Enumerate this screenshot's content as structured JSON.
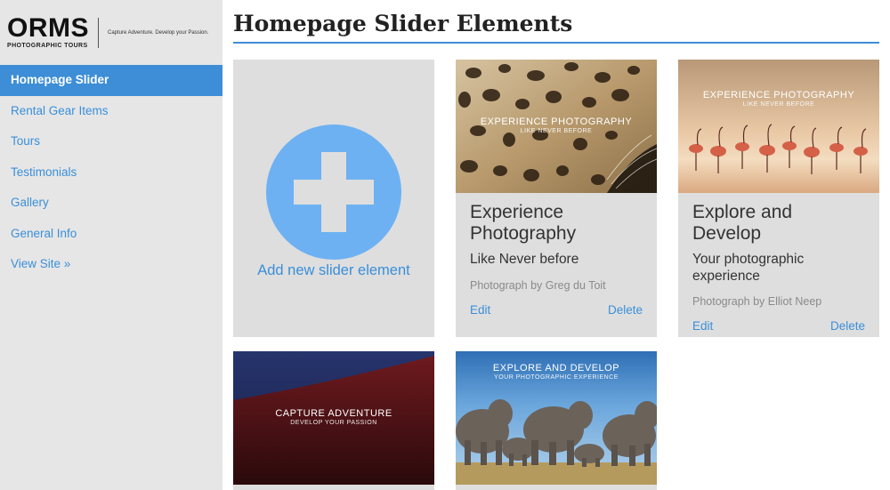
{
  "brand": {
    "logo_text": "ORMS",
    "logo_sub": "PHOTOGRAPHIC TOURS",
    "tagline": "Capture Adventure.  Develop your Passion."
  },
  "colors": {
    "accent": "#3d8ed6",
    "link": "#3a8fd9",
    "add_circle": "#6db1f2",
    "card_bg": "#dedede",
    "sidebar_bg": "#e6e6e6"
  },
  "nav": {
    "items": [
      {
        "label": "Homepage Slider",
        "active": true
      },
      {
        "label": "Rental Gear Items"
      },
      {
        "label": "Tours"
      },
      {
        "label": "Testimonials"
      },
      {
        "label": "Gallery"
      },
      {
        "label": "General Info"
      },
      {
        "label": "View Site »"
      }
    ]
  },
  "page": {
    "title": "Homepage Slider Elements"
  },
  "add_card": {
    "label": "Add new slider element",
    "icon": "plus-circle-icon"
  },
  "cards": [
    {
      "title": "Experience Photography",
      "subtitle": "Like Never before",
      "credit": "Photograph by Greg du Toit",
      "slide_heading": "EXPERIENCE PHOTOGRAPHY",
      "slide_tagline": "LIKE NEVER BEFORE",
      "edit": "Edit",
      "delete": "Delete"
    },
    {
      "title": "Explore and Develop",
      "subtitle": "Your photographic experience",
      "credit": "Photograph by Elliot Neep",
      "slide_heading": "EXPERIENCE PHOTOGRAPHY",
      "slide_tagline": "LIKE NEVER BEFORE",
      "edit": "Edit",
      "delete": "Delete"
    },
    {
      "slide_heading": "CAPTURE ADVENTURE",
      "slide_tagline": "DEVELOP YOUR PASSION"
    },
    {
      "slide_heading": "EXPLORE AND DEVELOP",
      "slide_tagline": "YOUR PHOTOGRAPHIC EXPERIENCE"
    }
  ]
}
